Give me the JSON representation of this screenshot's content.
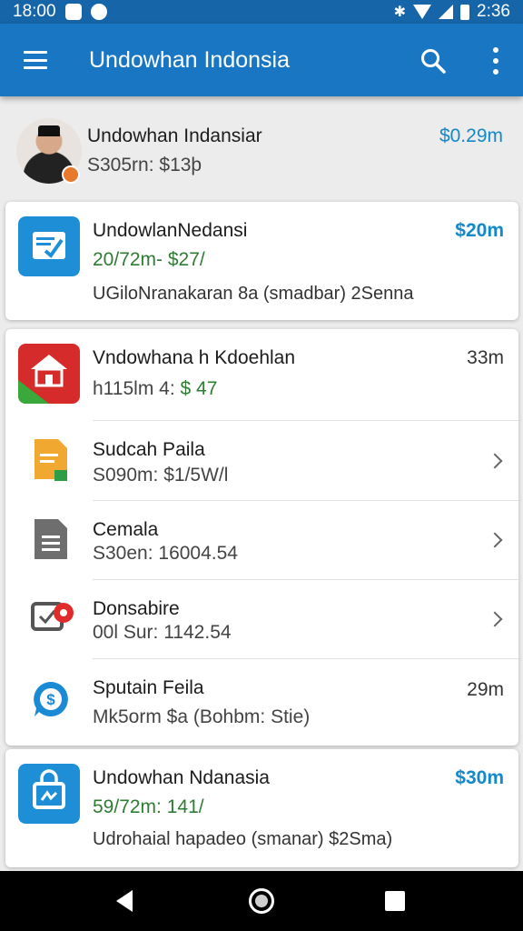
{
  "statusbar": {
    "time": "18:00",
    "right_text": "2:36"
  },
  "appbar": {
    "title": "Undowhan Indonsia"
  },
  "profile": {
    "name": "Undowhan Indansiar",
    "subtitle": "S305rn: $13þ",
    "amount": "$0.29m"
  },
  "card1": {
    "title": "UndowlanNedansi",
    "subtitle": "20/72m- $27/",
    "description": "UGiloNranakaran 8a (smadbar) 2Senna",
    "amount": "$20m"
  },
  "card2": {
    "items": [
      {
        "title": "Vndowhana h Kdoehlan",
        "subtitle_prefix": "h115lm 4: ",
        "subtitle_value": "$ 47",
        "amount": "33m"
      },
      {
        "title": "Sudcah Paila",
        "subtitle": "S090m: $1/5W/l"
      },
      {
        "title": "Cemala",
        "subtitle": "S30en: 16004.54"
      },
      {
        "title": "Donsabire",
        "subtitle": "00l Sur: 1142.54"
      },
      {
        "title": "Sputain Feila",
        "subtitle": "Mk5orm $a (Bohbm: Stie)",
        "amount": "29m"
      }
    ]
  },
  "card3": {
    "title": "Undowhan Ndanasia",
    "subtitle": "59/72m: 141/",
    "description": "Udrohaial hapadeo (smanar) $2Sma)",
    "amount": "$30m"
  },
  "colors": {
    "appbar": "#1976c2",
    "statusbar": "#1565a8",
    "accent_blue": "#1488c9",
    "green": "#2e7d32"
  },
  "icons": [
    "menu-icon",
    "search-icon",
    "more-vert-icon",
    "document-check-icon",
    "house-icon",
    "file-icon",
    "document-icon",
    "video-record-icon",
    "dollar-chat-icon",
    "shopping-bag-icon",
    "back-icon",
    "home-icon",
    "recents-icon"
  ]
}
